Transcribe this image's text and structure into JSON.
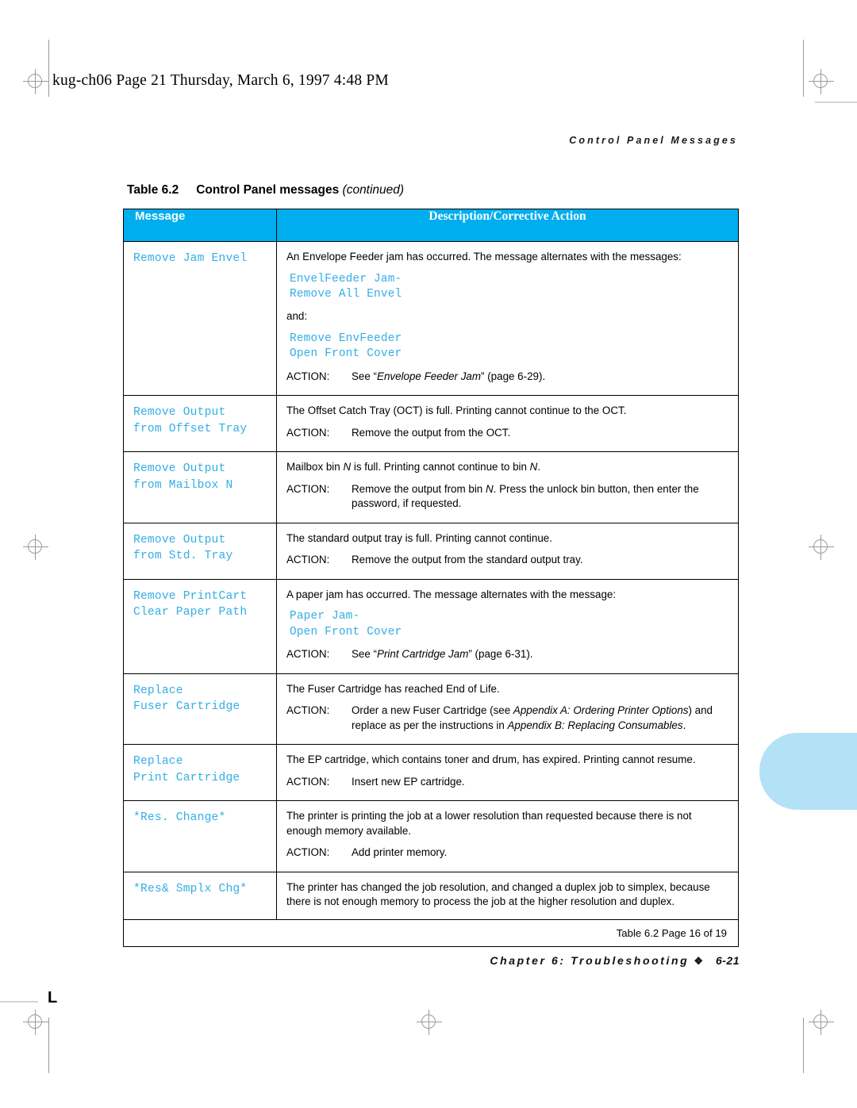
{
  "frame": {
    "filename_line": "kug-ch06  Page 21  Thursday, March 6, 1997  4:48 PM",
    "corner_mark": "L"
  },
  "running_head": "Control Panel Messages",
  "caption": {
    "number": "Table 6.2",
    "title": "Control Panel messages ",
    "continued": "(continued)"
  },
  "table": {
    "headers": {
      "message": "Message",
      "description": "Description/Corrective Action"
    },
    "rows": [
      {
        "message": "Remove Jam Envel",
        "blocks": [
          {
            "kind": "para",
            "text": "An Envelope Feeder jam has occurred. The message alternates with the messages:"
          },
          {
            "kind": "mono",
            "text": "EnvelFeeder Jam-\nRemove All Envel"
          },
          {
            "kind": "para",
            "text": "and:"
          },
          {
            "kind": "mono",
            "text": "Remove EnvFeeder\nOpen Front Cover"
          },
          {
            "kind": "action",
            "label": "ACTION:",
            "pre": "See “",
            "em": "Envelope Feeder Jam",
            "post": "” (page 6-29)."
          }
        ]
      },
      {
        "message": "Remove Output\nfrom Offset Tray",
        "blocks": [
          {
            "kind": "para",
            "text": "The Offset Catch Tray (OCT) is full. Printing cannot continue to the OCT."
          },
          {
            "kind": "action",
            "label": "ACTION:",
            "pre": "Remove the output from the OCT.",
            "em": "",
            "post": ""
          }
        ]
      },
      {
        "message": "Remove Output\nfrom Mailbox N",
        "blocks": [
          {
            "kind": "para_em",
            "pre": "Mailbox bin ",
            "em": "N",
            "post": " is full. Printing cannot continue to bin ",
            "em2": "N",
            "post2": "."
          },
          {
            "kind": "action",
            "label": "ACTION:",
            "pre": "Remove the output from bin ",
            "em": "N",
            "post": ". Press the unlock bin button, then enter the password, if requested."
          }
        ]
      },
      {
        "message": "Remove Output\nfrom Std. Tray",
        "blocks": [
          {
            "kind": "para",
            "text": "The standard output tray is full. Printing cannot continue."
          },
          {
            "kind": "action",
            "label": "ACTION:",
            "pre": "Remove the output from the standard output tray.",
            "em": "",
            "post": ""
          }
        ]
      },
      {
        "message": "Remove PrintCart\nClear Paper Path",
        "blocks": [
          {
            "kind": "para",
            "text": "A paper jam has occurred. The message alternates with the message:"
          },
          {
            "kind": "mono",
            "text": "Paper Jam-\nOpen Front Cover"
          },
          {
            "kind": "action",
            "label": "ACTION:",
            "pre": "See “",
            "em": "Print Cartridge Jam",
            "post": "” (page 6-31)."
          }
        ]
      },
      {
        "message": "Replace\nFuser Cartridge",
        "blocks": [
          {
            "kind": "para",
            "text": "The Fuser Cartridge has reached End of Life."
          },
          {
            "kind": "action_multi",
            "label": "ACTION:",
            "parts": [
              {
                "t": "Order a new Fuser Cartridge (see ",
                "i": false
              },
              {
                "t": "Appendix A: Ordering Printer Options",
                "i": true
              },
              {
                "t": ") and replace as per the instructions in ",
                "i": false
              },
              {
                "t": "Appendix B: Replacing Consumables",
                "i": true
              },
              {
                "t": ".",
                "i": false
              }
            ]
          }
        ]
      },
      {
        "message": "Replace\nPrint Cartridge",
        "blocks": [
          {
            "kind": "para",
            "text": "The EP cartridge, which contains toner and drum, has expired. Printing cannot resume."
          },
          {
            "kind": "action",
            "label": "ACTION:",
            "pre": "Insert new EP cartridge.",
            "em": "",
            "post": ""
          }
        ]
      },
      {
        "message": "*Res. Change*",
        "blocks": [
          {
            "kind": "para",
            "text": "The printer is printing the job at a lower resolution than requested because there is not enough memory available."
          },
          {
            "kind": "action",
            "label": "ACTION:",
            "pre": "Add printer memory.",
            "em": "",
            "post": ""
          }
        ]
      },
      {
        "message": "*Res& Smplx Chg*",
        "blocks": [
          {
            "kind": "para",
            "text": "The printer has changed the job resolution, and changed a duplex job to simplex, because there is not enough memory to process the job at the higher resolution and duplex."
          }
        ]
      }
    ],
    "footer_note": "Table 6.2  Page 16 of 19"
  },
  "page_footer": {
    "chapter": "Chapter 6: Troubleshooting",
    "diamond": "❖",
    "folio": "6-21"
  },
  "colors": {
    "header_bg": "#00AEEF",
    "message_text": "#33AEE5",
    "thumb_tab": "#B3E2F7"
  }
}
